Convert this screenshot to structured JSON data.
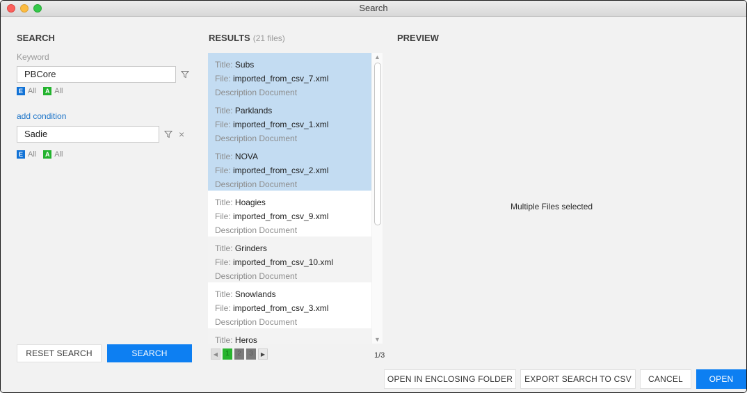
{
  "window": {
    "title": "Search"
  },
  "search": {
    "heading": "SEARCH",
    "keyword_label": "Keyword",
    "conditions": [
      {
        "value": "PBCore",
        "scope_e": "All",
        "scope_a": "All"
      },
      {
        "value": "Sadie",
        "scope_e": "All",
        "scope_a": "All"
      }
    ],
    "add_condition": "add condition",
    "reset_button": "RESET SEARCH",
    "search_button": "SEARCH"
  },
  "results": {
    "heading": "RESULTS",
    "count": "(21 files)",
    "items": [
      {
        "title": "Subs",
        "file": "imported_from_csv_7.xml",
        "desc": "Description Document",
        "selected": true
      },
      {
        "title": "Parklands",
        "file": "imported_from_csv_1.xml",
        "desc": "Description Document",
        "selected": true
      },
      {
        "title": "NOVA",
        "file": "imported_from_csv_2.xml",
        "desc": "Description Document",
        "selected": true
      },
      {
        "title": "Hoagies",
        "file": "imported_from_csv_9.xml",
        "desc": "Description Document",
        "selected": false
      },
      {
        "title": "Grinders",
        "file": "imported_from_csv_10.xml",
        "desc": "Description Document",
        "selected": false
      },
      {
        "title": "Snowlands",
        "file": "imported_from_csv_3.xml",
        "desc": "Description Document",
        "selected": false
      },
      {
        "title": "Heros",
        "file": "",
        "desc": "",
        "selected": false
      }
    ],
    "labels": {
      "title": "Title:",
      "file": "File:"
    },
    "pages": [
      "1",
      "2",
      "3"
    ],
    "current_page": "1",
    "page_indicator": "1/3"
  },
  "preview": {
    "heading": "PREVIEW",
    "message": "Multiple Files selected"
  },
  "footer": {
    "open_folder": "OPEN IN ENCLOSING FOLDER",
    "export_csv": "EXPORT SEARCH TO CSV",
    "cancel": "CANCEL",
    "open": "OPEN"
  },
  "colors": {
    "accent_blue": "#0d7ff2",
    "selected_row": "#c3dcf2",
    "badge_e": "#1172d6",
    "badge_a": "#22b32d"
  }
}
